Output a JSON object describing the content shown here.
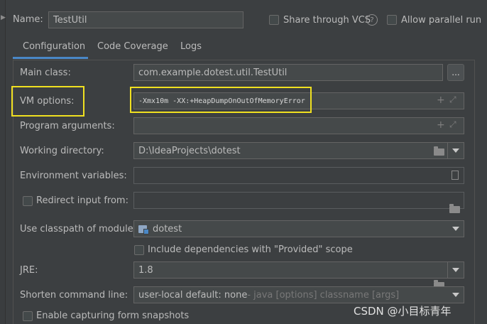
{
  "header": {
    "name_label": "Name:",
    "name_value": "TestUtil",
    "share_vcs_label": "Share through VCS",
    "allow_parallel_label": "Allow parallel run"
  },
  "tabs": [
    {
      "label": "Configuration",
      "active": true
    },
    {
      "label": "Code Coverage",
      "active": false
    },
    {
      "label": "Logs",
      "active": false
    }
  ],
  "form": {
    "main_class_label": "Main class:",
    "main_class_value": "com.example.dotest.util.TestUtil",
    "browse_label": "...",
    "vm_options_label": "VM options:",
    "vm_options_value": "-Xmx10m -XX:+HeapDumpOnOutOfMemoryError",
    "program_args_label": "Program arguments:",
    "program_args_value": "",
    "working_dir_label": "Working directory:",
    "working_dir_value": "D:\\IdeaProjects\\dotest",
    "env_vars_label": "Environment variables:",
    "env_vars_value": "",
    "redirect_input_label": "Redirect input from:",
    "classpath_label": "Use classpath of module:",
    "classpath_value": "dotest",
    "include_deps_label": "Include dependencies with \"Provided\" scope",
    "jre_label": "JRE:",
    "jre_value": "1.8",
    "shorten_label": "Shorten command line:",
    "shorten_value": "user-local default: none",
    "shorten_hint": " - java [options] classname [args]",
    "capture_snapshots_label": "Enable capturing form snapshots"
  },
  "watermark": "CSDN @小目标青年",
  "colors": {
    "background": "#3c3f41",
    "field": "#45494a",
    "accent": "#4a88c7",
    "highlight": "#f0e020"
  }
}
